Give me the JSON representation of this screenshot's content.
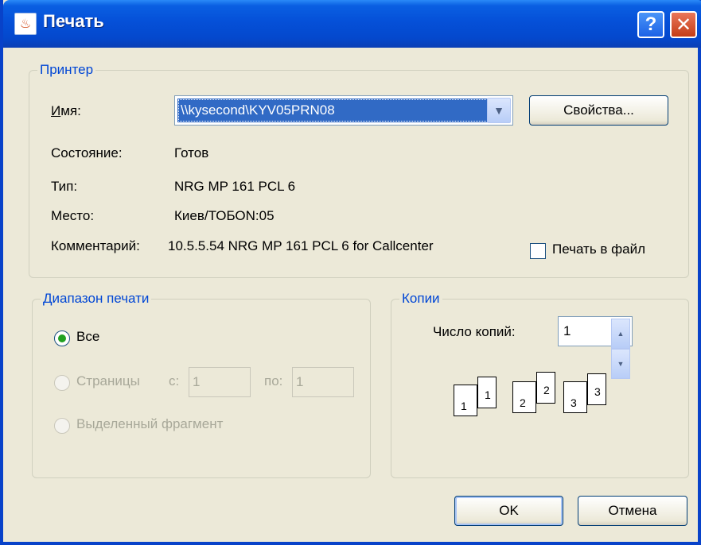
{
  "window": {
    "title": "Печать",
    "icon": "java-cup-icon",
    "help_label": "?",
    "close_label": "✕"
  },
  "printer": {
    "legend": "Принтер",
    "name_label": "Имя:",
    "name_value": "\\\\kysecond\\KYV05PRN08",
    "properties_label": "Свойства...",
    "status_label": "Состояние:",
    "status_value": "Готов",
    "type_label": "Тип:",
    "type_value": "NRG MP 161 PCL 6",
    "location_label": "Место:",
    "location_value": "Киев/ТОБОN:05",
    "comment_label": "Комментарий:",
    "comment_value": "10.5.5.54 NRG MP 161 PCL 6 for Callcenter",
    "print_to_file_label": "Печать в файл",
    "print_to_file_checked": false
  },
  "range": {
    "legend": "Диапазон печати",
    "all_label": "Все",
    "pages_label": "Страницы",
    "from_label": "с:",
    "from_value": "1",
    "to_label": "по:",
    "to_value": "1",
    "selection_label": "Выделенный фрагмент",
    "selected": "all"
  },
  "copies": {
    "legend": "Копии",
    "count_label": "Число копий:",
    "count_value": "1",
    "collate_pages": [
      "1",
      "1",
      "2",
      "2",
      "3",
      "3"
    ]
  },
  "buttons": {
    "ok_label": "OK",
    "cancel_label": "Отмена"
  }
}
